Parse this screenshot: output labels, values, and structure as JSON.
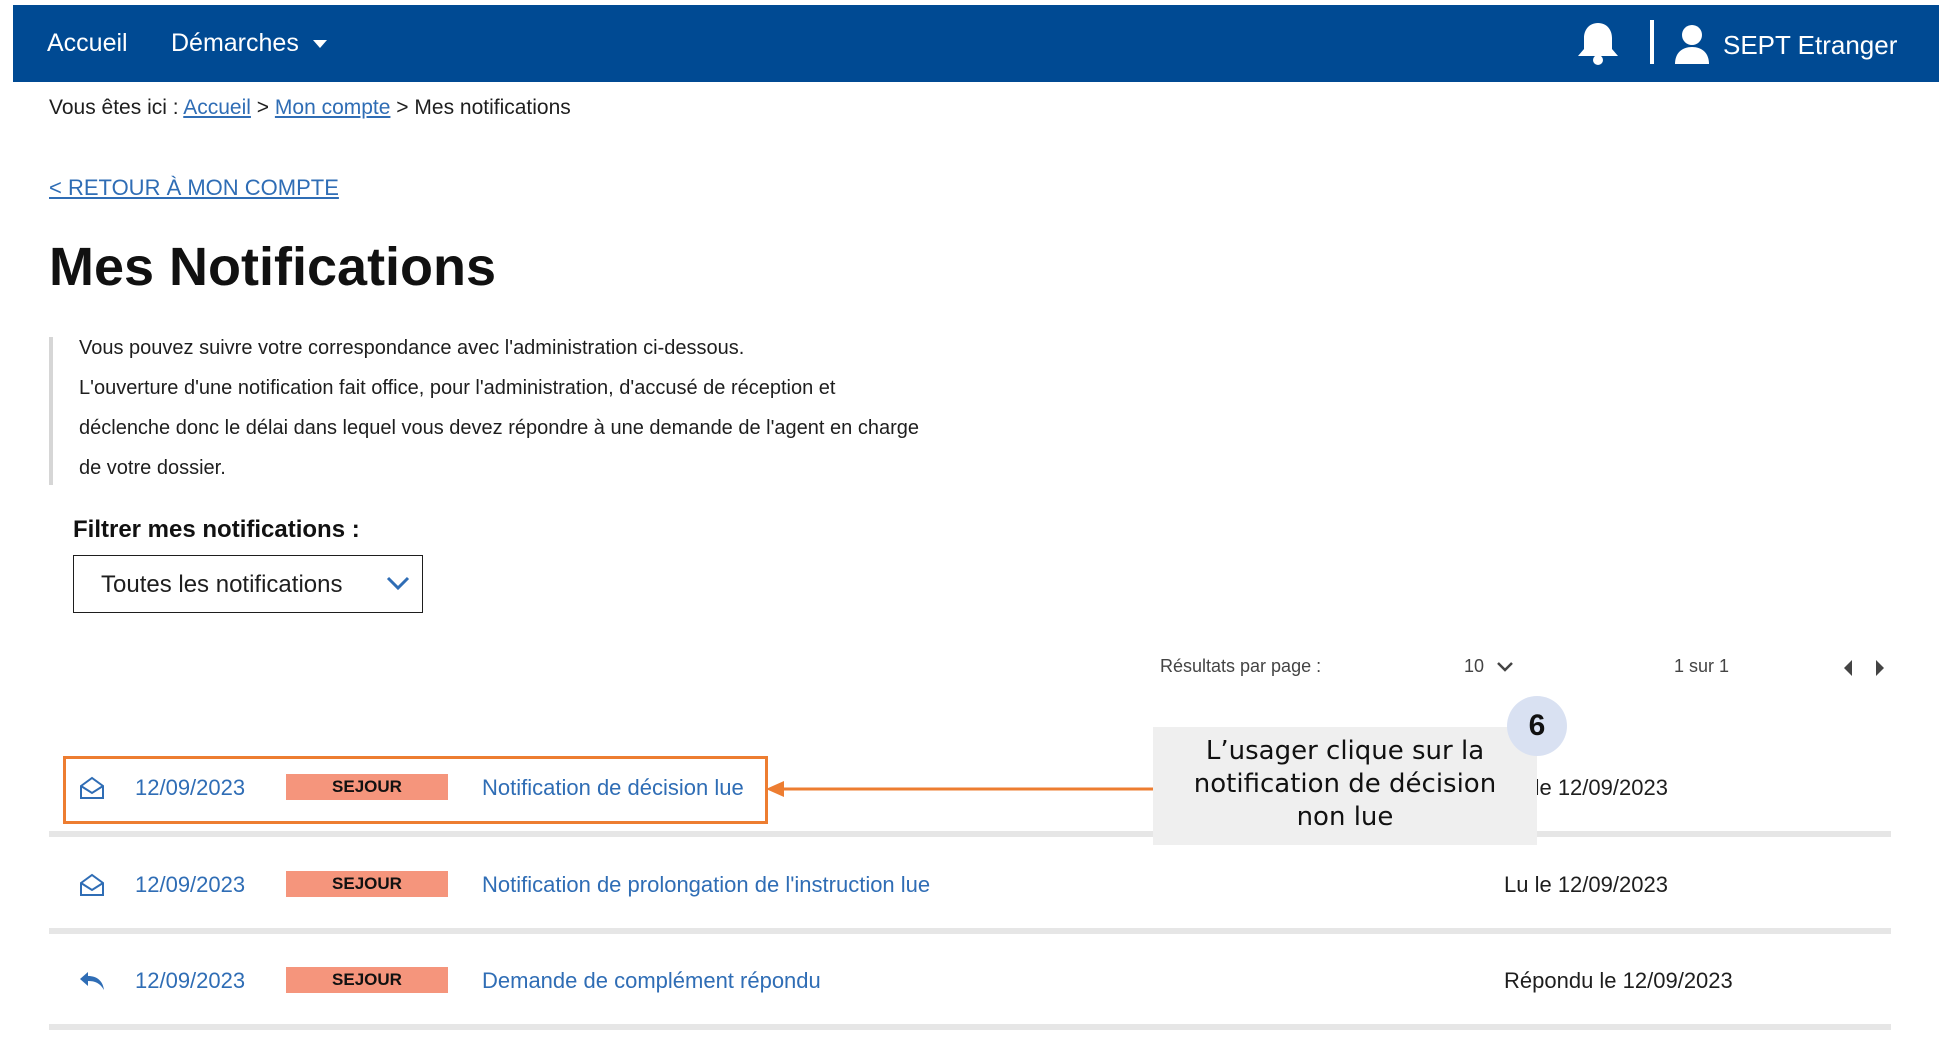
{
  "header": {
    "nav_home": "Accueil",
    "nav_demarches": "Démarches",
    "user_name": "SEPT Etranger",
    "bar_color": "#004a93"
  },
  "breadcrumb": {
    "prefix": "Vous êtes ici : ",
    "home": "Accueil",
    "sep1": " > ",
    "account": "Mon compte",
    "sep2": " > ",
    "current": "Mes notifications"
  },
  "back_link": "< RETOUR À MON COMPTE",
  "title": "Mes Notifications",
  "intro": {
    "line1": "Vous pouvez suivre votre correspondance avec l'administration ci-dessous.",
    "line2": "L'ouverture d'une notification fait office, pour l'administration, d'accusé de réception et",
    "line3": "déclenche donc le délai dans lequel vous devez répondre à une demande de l'agent en charge",
    "line4": "de votre dossier."
  },
  "filter": {
    "label": "Filtrer mes notifications :",
    "selected": "Toutes les notifications"
  },
  "pagination": {
    "results_label": "Résultats par page :",
    "per_page": "10",
    "page_info": "1 sur 1"
  },
  "notifications": [
    {
      "icon": "envelope-open-icon",
      "date": "12/09/2023",
      "tag": "SEJOUR",
      "label": "Notification de décision lue",
      "status": "Lu le 12/09/2023"
    },
    {
      "icon": "envelope-open-icon",
      "date": "12/09/2023",
      "tag": "SEJOUR",
      "label": "Notification de prolongation de l'instruction lue",
      "status": "Lu le 12/09/2023"
    },
    {
      "icon": "reply-icon",
      "date": "12/09/2023",
      "tag": "SEJOUR",
      "label": "Demande de complément répondu",
      "status": "Répondu le 12/09/2023"
    }
  ],
  "annotation": {
    "step": "6",
    "line1": "L’usager clique sur la",
    "line2": "notification de décision",
    "line3": "non lue",
    "highlight_color": "#ed7d31"
  },
  "colors": {
    "link": "#2f6db5",
    "tag_bg": "#f5957c",
    "divider": "#e6e6e6"
  }
}
